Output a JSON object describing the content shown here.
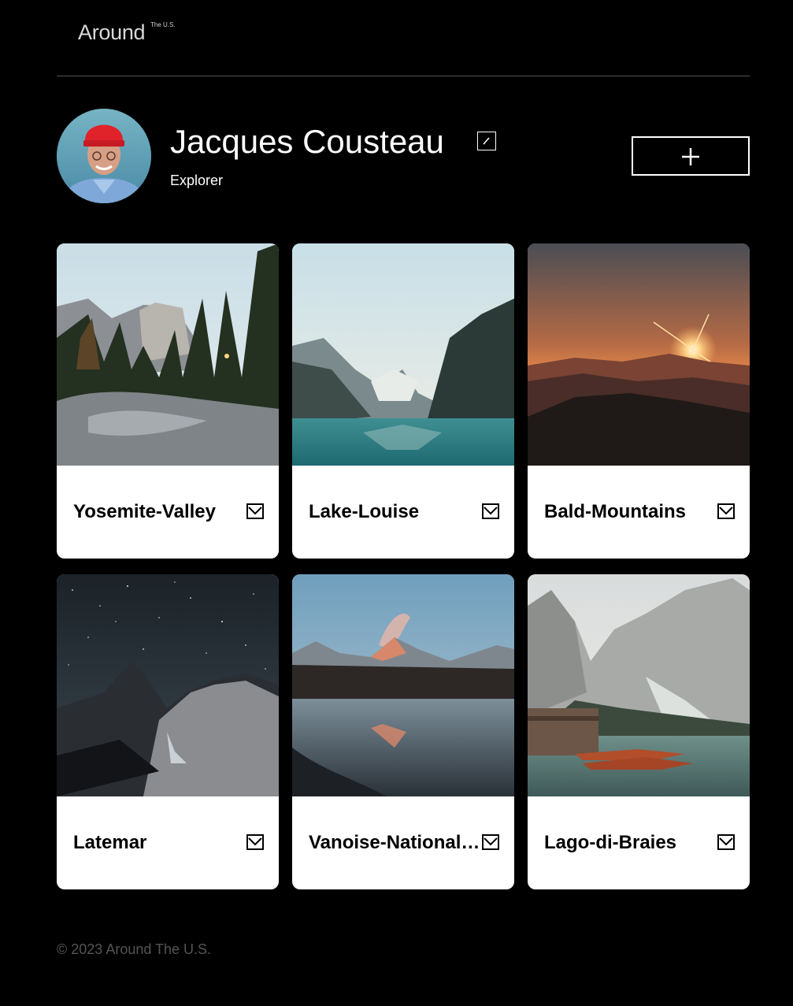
{
  "header": {
    "logo_text": "Around",
    "logo_sup": "The U.S."
  },
  "profile": {
    "name": "Jacques Cousteau",
    "job": "Explorer"
  },
  "cards": [
    {
      "title": "Yosemite-Valley"
    },
    {
      "title": "Lake-Louise"
    },
    {
      "title": "Bald-Mountains"
    },
    {
      "title": "Latemar"
    },
    {
      "title": "Vanoise-National-Park"
    },
    {
      "title": "Lago-di-Braies"
    }
  ],
  "footer": {
    "copyright": "© 2023 Around The U.S."
  },
  "colors": {
    "background": "#000000",
    "card": "#ffffff",
    "footer_text": "#545454"
  }
}
